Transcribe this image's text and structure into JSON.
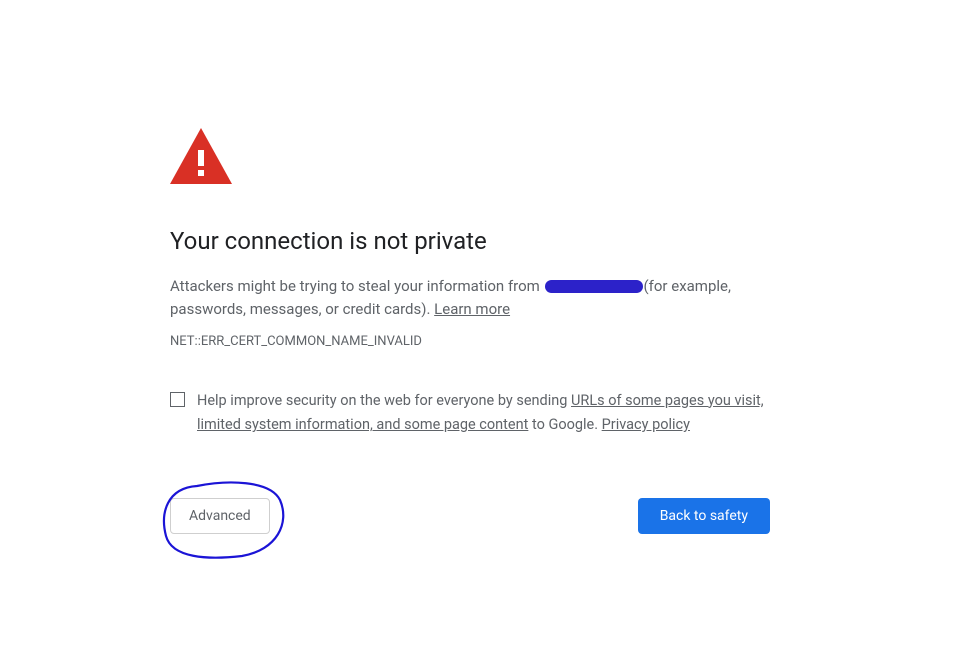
{
  "title": "Your connection is not private",
  "description_prefix": "Attackers might be trying to steal your information from ",
  "description_suffix": "(for example, passwords, messages, or credit cards). ",
  "learn_more": "Learn more",
  "error_code": "NET::ERR_CERT_COMMON_NAME_INVALID",
  "optin": {
    "prefix": "Help improve security on the web for everyone by sending ",
    "link1": "URLs of some pages you visit, limited system information, and some page content",
    "middle": " to Google. ",
    "privacy": "Privacy policy"
  },
  "buttons": {
    "advanced": "Advanced",
    "back_to_safety": "Back to safety"
  }
}
